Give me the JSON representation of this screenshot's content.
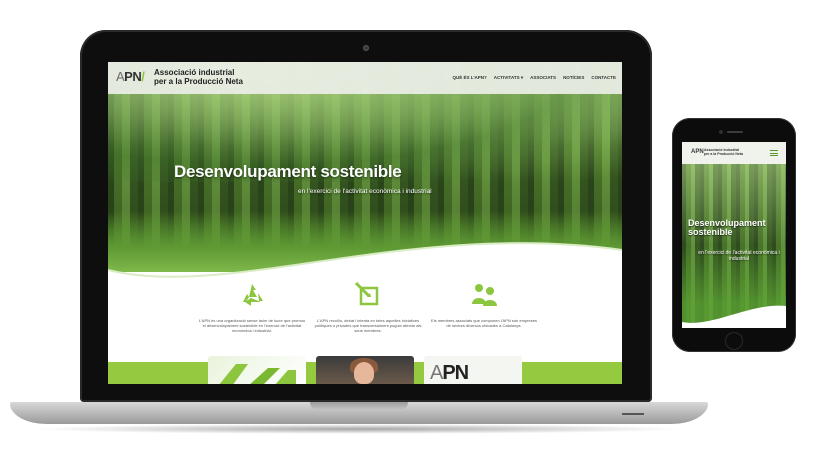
{
  "laptop_site": {
    "logo": {
      "prefix": "A",
      "main": "PN",
      "mark": "/"
    },
    "org_name_line1": "Associació industrial",
    "org_name_line2": "per a la Producció Neta",
    "nav": [
      {
        "label": "QUÈ ÉS L'APN?"
      },
      {
        "label": "ACTIVITATS ▾"
      },
      {
        "label": "ASSOCIATS"
      },
      {
        "label": "NOTÍCIES"
      },
      {
        "label": "CONTACTE"
      }
    ],
    "hero_title": "Desenvolupament sostenible",
    "hero_subtitle": "en l'exercici de l'activitat econòmica i industrial",
    "features": [
      {
        "icon": "recycle-icon",
        "text": "L'APN és una organització sense ànim de lucre que promou el desenvolupament sostenible en l'exercici de l'activitat econòmica i industrial."
      },
      {
        "icon": "edit-note-icon",
        "text": "L'APN recolliu, debat i intenta en totes aquelles iniciatives polítiques o privades que transversalment puguin afectar als seus membres."
      },
      {
        "icon": "people-icon",
        "text": "Els membres associats que componen l'APN són empreses de sectors diversos ubicades a Catalunya."
      }
    ],
    "cards": [
      {
        "icon": "recycle-arrows-image"
      },
      {
        "icon": "woman-portrait-image"
      },
      {
        "label": "PN",
        "prefix": "A"
      }
    ]
  },
  "phone_site": {
    "logo": "APN",
    "org_name_line1": "Associació industrial",
    "org_name_line2": "per a la Producció Neta",
    "hero_title": "Desenvolupament sostenible",
    "hero_subtitle": "en l'exercici de l'activitat econòmica i industrial"
  },
  "colors": {
    "accent_green": "#8cc63f",
    "floor_green": "#95c93f",
    "device_frame": "#0e0e0e"
  }
}
